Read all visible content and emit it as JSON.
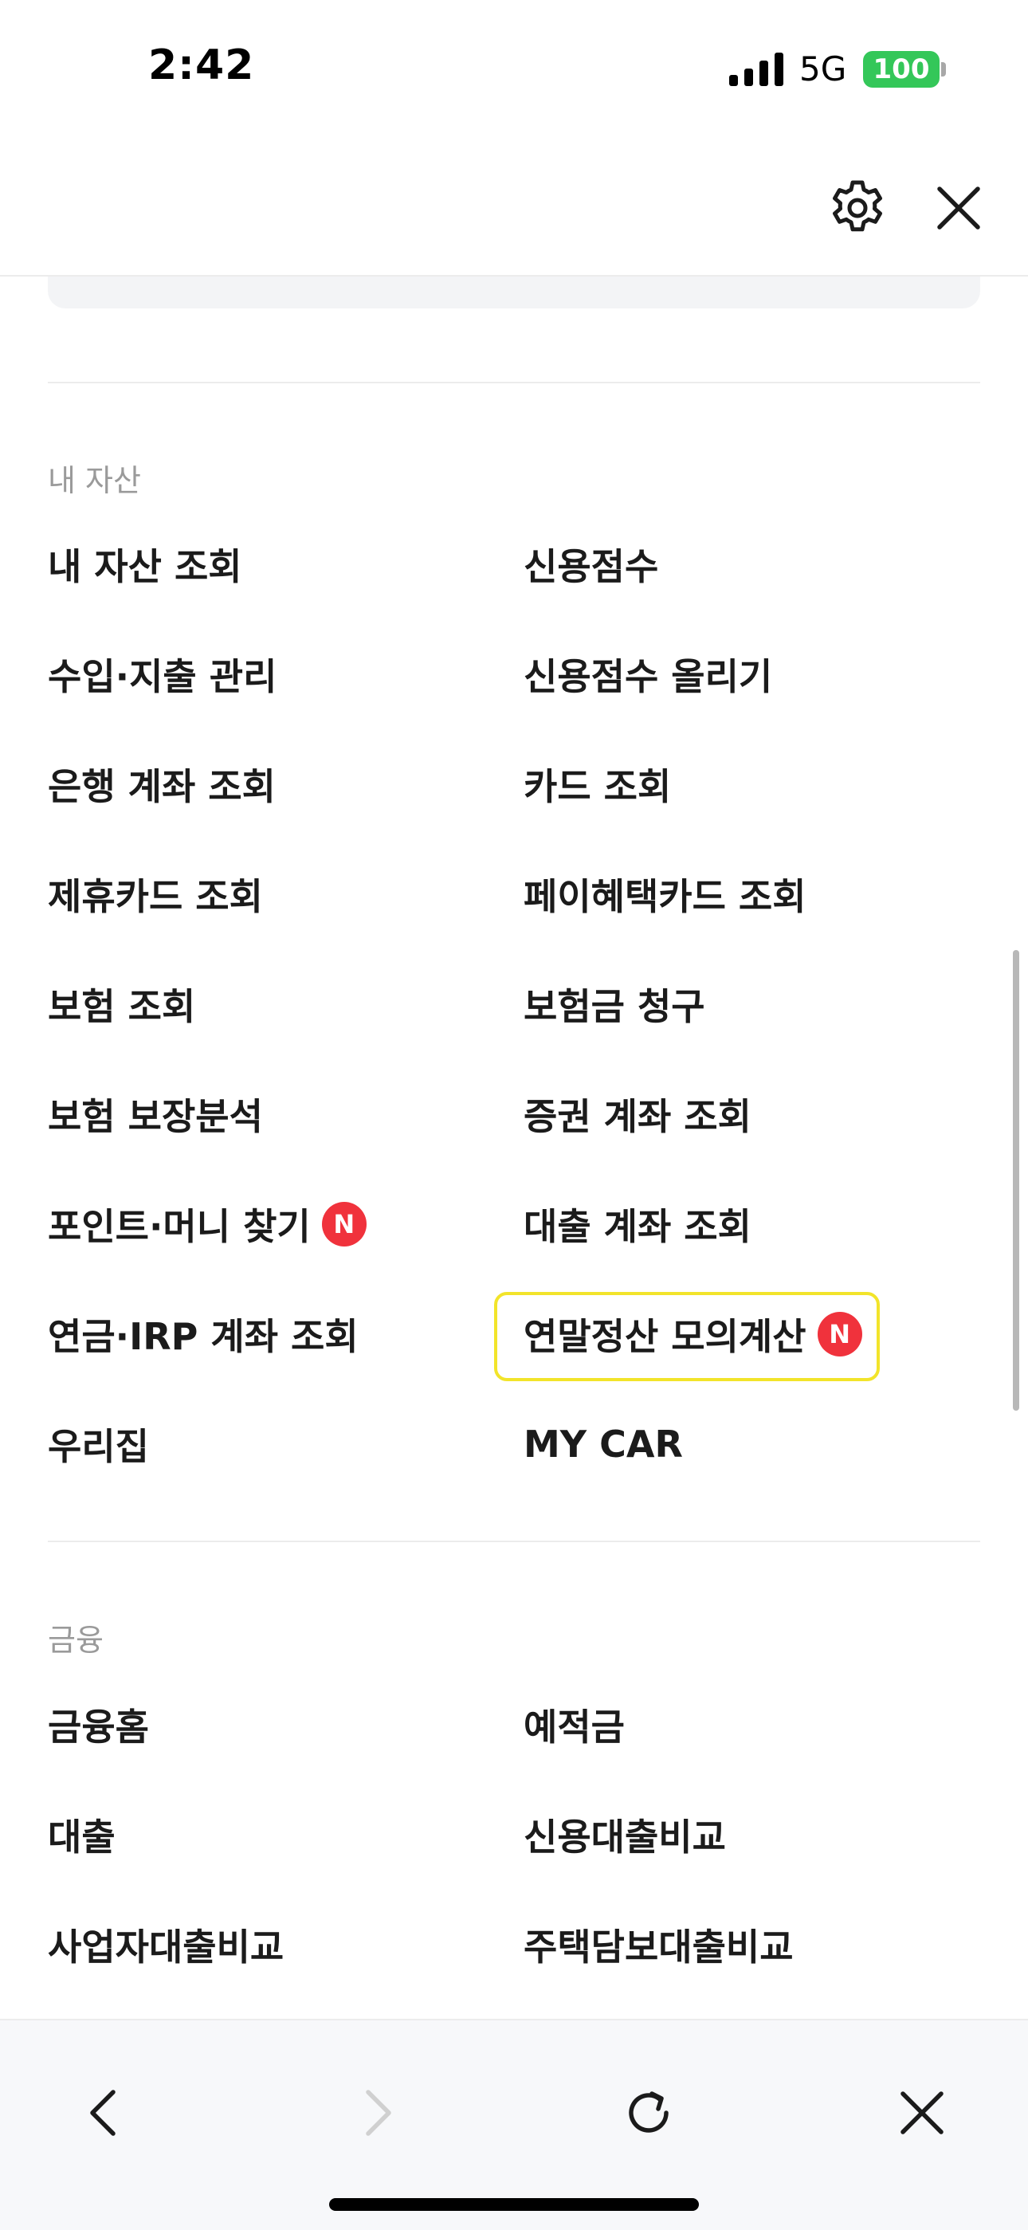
{
  "status_bar": {
    "time": "2:42",
    "network": "5G",
    "battery": "100"
  },
  "header": {
    "settings_icon": "gear-icon",
    "close_icon": "close-icon"
  },
  "sections": {
    "assets": {
      "title": "내 자산",
      "items": [
        {
          "label": "내 자산 조회"
        },
        {
          "label": "신용점수"
        },
        {
          "label": "수입·지출 관리"
        },
        {
          "label": "신용점수 올리기"
        },
        {
          "label": "은행 계좌 조회"
        },
        {
          "label": "카드 조회"
        },
        {
          "label": "제휴카드 조회"
        },
        {
          "label": "페이혜택카드 조회"
        },
        {
          "label": "보험 조회"
        },
        {
          "label": "보험금 청구"
        },
        {
          "label": "보험 보장분석"
        },
        {
          "label": "증권 계좌 조회"
        },
        {
          "label": "포인트·머니 찾기",
          "badge": "N"
        },
        {
          "label": "대출 계좌 조회"
        },
        {
          "label": "연금·IRP 계좌 조회"
        },
        {
          "label": "연말정산 모의계산",
          "badge": "N",
          "highlighted": true
        },
        {
          "label": "우리집"
        },
        {
          "label": "MY CAR"
        }
      ]
    },
    "finance": {
      "title": "금융",
      "items": [
        {
          "label": "금융홈"
        },
        {
          "label": "예적금"
        },
        {
          "label": "대출"
        },
        {
          "label": "신용대출비교"
        },
        {
          "label": "사업자대출비교"
        },
        {
          "label": "주택담보대출비교"
        }
      ]
    }
  },
  "toolbar": {
    "back_icon": "chevron-left-icon",
    "forward_icon": "chevron-right-icon",
    "reload_icon": "reload-icon",
    "close_icon": "close-icon"
  },
  "colors": {
    "badge": "#f0323c",
    "highlight": "#f2e42a",
    "battery": "#34c759",
    "section_title": "#9a9a9a"
  }
}
